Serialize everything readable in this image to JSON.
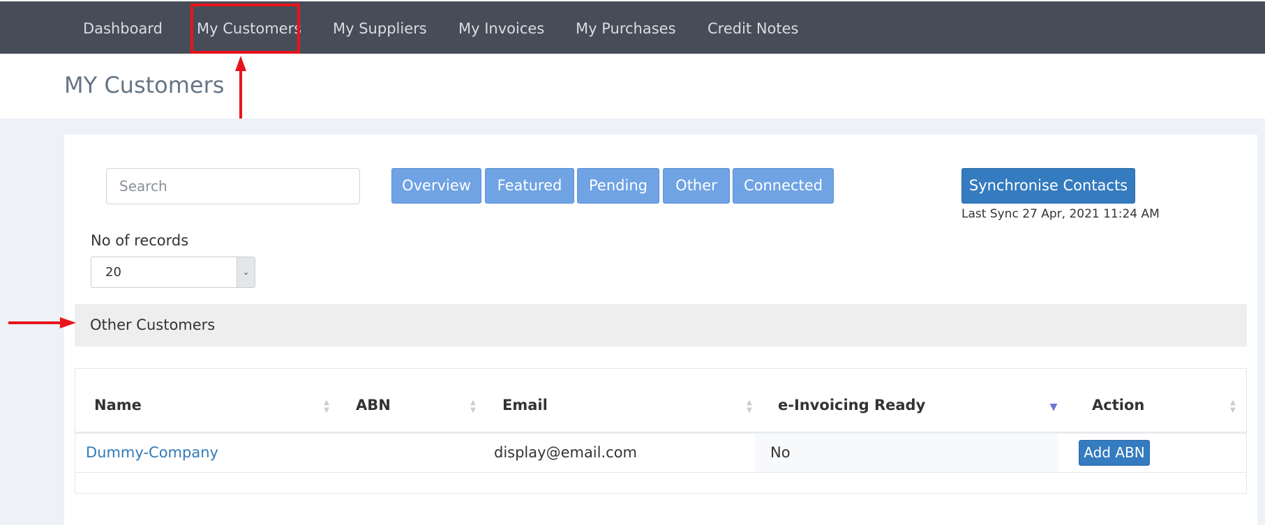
{
  "nav": {
    "items": [
      {
        "label": "Dashboard"
      },
      {
        "label": "My Customers"
      },
      {
        "label": "My Suppliers"
      },
      {
        "label": "My Invoices"
      },
      {
        "label": "My Purchases"
      },
      {
        "label": "Credit Notes"
      }
    ]
  },
  "page": {
    "title": "MY Customers"
  },
  "toolbar": {
    "search_placeholder": "Search",
    "tabs": [
      {
        "label": "Overview"
      },
      {
        "label": "Featured"
      },
      {
        "label": "Pending"
      },
      {
        "label": "Other"
      },
      {
        "label": "Connected"
      }
    ],
    "sync_label": "Synchronise Contacts",
    "last_sync": "Last Sync 27 Apr, 2021 11:24 AM"
  },
  "records": {
    "label": "No of records",
    "value": "20"
  },
  "section": {
    "title": "Other Customers"
  },
  "table": {
    "columns": [
      {
        "label": "Name"
      },
      {
        "label": "ABN"
      },
      {
        "label": "Email"
      },
      {
        "label": "e-Invoicing Ready"
      },
      {
        "label": "Action"
      }
    ],
    "rows": [
      {
        "name": "Dummy-Company",
        "abn": "",
        "email": "display@email.com",
        "einvoicing": "No",
        "action": "Add ABN"
      }
    ]
  },
  "annotations": {
    "color": "#e8141b"
  },
  "colors": {
    "navbar": "#464d58",
    "tab": "#6fa3e3",
    "primary_button": "#357bbf",
    "link": "#337ab7"
  }
}
